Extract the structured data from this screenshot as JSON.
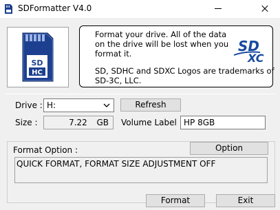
{
  "window": {
    "title": "SDFormatter V4.0"
  },
  "info": {
    "line1": "Format your drive. All of the data",
    "line2": "on the drive will be lost when you",
    "line3": "format it.",
    "line4": "SD, SDHC and SDXC Logos are trademarks of",
    "line5": "SD-3C, LLC.",
    "sd_card_logo_text": "SD HC",
    "sdxc_logo_text": "SD XC"
  },
  "drive": {
    "label": "Drive :",
    "value": "H:",
    "refresh_label": "Refresh"
  },
  "size": {
    "label": "Size :",
    "value": "7.22",
    "unit": "GB"
  },
  "volume": {
    "label": "Volume Label :",
    "value": "HP 8GB"
  },
  "format_option": {
    "label": "Format Option :",
    "option_button": "Option",
    "current": "QUICK FORMAT, FORMAT SIZE ADJUSTMENT OFF"
  },
  "actions": {
    "format_label": "Format",
    "exit_label": "Exit"
  },
  "colors": {
    "sd_blue": "#1c3f8f",
    "logo_blue": "#1a4aa0",
    "window_bg": "#f0f0f0"
  }
}
